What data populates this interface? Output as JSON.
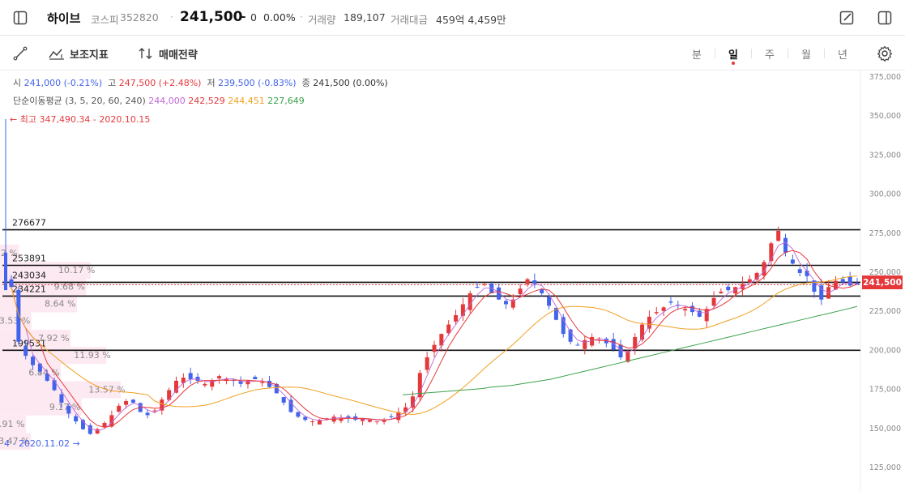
{
  "header": {
    "name": "하이브",
    "market": "코스피",
    "code": "352820",
    "separator": "·",
    "price": "241,500",
    "change_sign": "–",
    "change": "0",
    "change_pct": "0.00%",
    "volume_label": "거래량",
    "volume": "189,107",
    "amount_label": "거래대금",
    "amount": "459억 4,459만"
  },
  "toolbar": {
    "indicator_label": "보조지표",
    "strategy_label": "매매전략",
    "periods": [
      "분",
      "일",
      "주",
      "월",
      "년"
    ],
    "active_period": "일"
  },
  "ohlc": {
    "open_label": "시",
    "open": "241,000 (-0.21%)",
    "high_label": "고",
    "high": "247,500 (+2.48%)",
    "low_label": "저",
    "low": "239,500 (-0.83%)",
    "close_label": "종",
    "close": "241,500 (0.00%)"
  },
  "ma": {
    "label": "단순이동평균 (3, 5, 20, 60, 240)",
    "v1": "244,000",
    "v2": "242,529",
    "v3": "244,451",
    "v4": "227,649"
  },
  "annotations": {
    "high": "← 최고 347,490.34 - 2020.10.15",
    "low": "4 - 2020.11.02 →"
  },
  "current_price_tag": "241,500",
  "colors": {
    "up": "#e5383b",
    "down": "#4263eb",
    "ma5": "#c065d8",
    "ma20": "#e5383b",
    "ma60": "#f0a020",
    "ma240": "#3aa24a"
  },
  "chart_data": {
    "type": "candlestick",
    "y_axis_ticks": [
      "375,000",
      "350,000",
      "325,000",
      "300,000",
      "275,000",
      "250,000",
      "225,000",
      "200,000",
      "175,000",
      "150,000",
      "125,000"
    ],
    "ylim": [
      113000,
      380000
    ],
    "current_price": 241500,
    "horizontal_levels": [
      {
        "label": "276677",
        "value": 276677
      },
      {
        "label": "253891",
        "value": 253891
      },
      {
        "label": "243034",
        "value": 243034
      },
      {
        "label": "234221",
        "value": 234221
      },
      {
        "label": "199531",
        "value": 199531
      }
    ],
    "volume_profile": [
      {
        "label": "2.12 %",
        "price": 262000
      },
      {
        "label": "10.17 %",
        "price": 251000
      },
      {
        "label": "9.68 %",
        "price": 240500
      },
      {
        "label": "8.64 %",
        "price": 229500
      },
      {
        "label": "3.53 %",
        "price": 218500
      },
      {
        "label": "7.92 %",
        "price": 207500
      },
      {
        "label": "11.93 %",
        "price": 196500
      },
      {
        "label": "6.84 %",
        "price": 185500
      },
      {
        "label": "13.57 %",
        "price": 174500
      },
      {
        "label": "9.17 %",
        "price": 163500
      },
      {
        "label": "2.91 %",
        "price": 152500
      },
      {
        "label": "3.47 %",
        "price": 141500
      }
    ],
    "closes": [
      240000,
      205000,
      196000,
      190000,
      186000,
      180000,
      174000,
      166000,
      159000,
      154000,
      149000,
      146000,
      149000,
      153000,
      158000,
      164000,
      167000,
      166000,
      160000,
      158000,
      161000,
      168000,
      174000,
      180000,
      182000,
      181000,
      180000,
      178000,
      180000,
      183000,
      181000,
      180000,
      178000,
      180000,
      181000,
      179000,
      176000,
      172000,
      166000,
      160000,
      157000,
      155000,
      154000,
      155000,
      156000,
      157000,
      156000,
      156000,
      155000,
      156000,
      155000,
      154000,
      155000,
      157000,
      160000,
      163000,
      170000,
      185000,
      195000,
      203000,
      210000,
      216000,
      222000,
      229000,
      236000,
      240000,
      242000,
      236000,
      232000,
      229000,
      232000,
      239000,
      245000,
      242000,
      236000,
      228000,
      219000,
      210000,
      205000,
      203000,
      206000,
      208000,
      207000,
      204000,
      200000,
      195000,
      199000,
      208000,
      216000,
      221000,
      224000,
      227000,
      230000,
      228000,
      226000,
      224000,
      221000,
      226000,
      233000,
      237000,
      238000,
      240000,
      242000,
      245000,
      249000,
      256000,
      268000,
      276000,
      262000,
      255000,
      249000,
      247000,
      237000,
      232000,
      240000,
      244000,
      243000,
      241000,
      241500
    ],
    "ma_240": [
      171000,
      171500,
      172000,
      172500,
      173000,
      173500,
      174000,
      174500,
      175000,
      176000,
      176500,
      177000,
      178000,
      179000,
      180000,
      181000,
      182500,
      184000,
      185500,
      187000,
      188500,
      190000,
      191500,
      193000,
      194500,
      196000,
      197500,
      199000,
      200500,
      202000,
      203500,
      205000,
      206500,
      208000,
      209500,
      211000,
      212500,
      214000,
      215500,
      217000,
      218500,
      220000,
      221500,
      223000,
      224500,
      226000,
      227649
    ]
  }
}
